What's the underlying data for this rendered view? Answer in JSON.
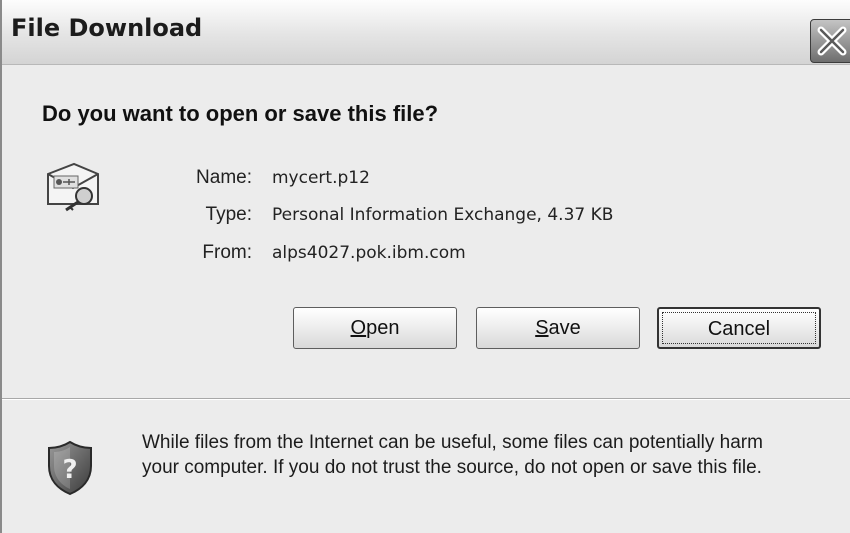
{
  "window": {
    "title": "File Download"
  },
  "dialog": {
    "question": "Do you want to open or save this file?",
    "file": {
      "name_label": "Name:",
      "name_value": "mycert.p12",
      "type_label": "Type:",
      "type_value": "Personal Information Exchange, 4.37 KB",
      "from_label": "From:",
      "from_value": "alps4027.pok.ibm.com"
    },
    "buttons": {
      "open_mnemonic": "O",
      "open_rest": "pen",
      "save_mnemonic": "S",
      "save_rest": "ave",
      "cancel": "Cancel"
    },
    "warning": {
      "line1": "While files from the Internet can be useful, some files can potentially harm",
      "line2": "your computer. If you do not trust the source, do not open or save this file."
    }
  },
  "icons": {
    "close": "close-icon",
    "file_type": "certificate-file-icon",
    "warning": "shield-question-icon"
  }
}
